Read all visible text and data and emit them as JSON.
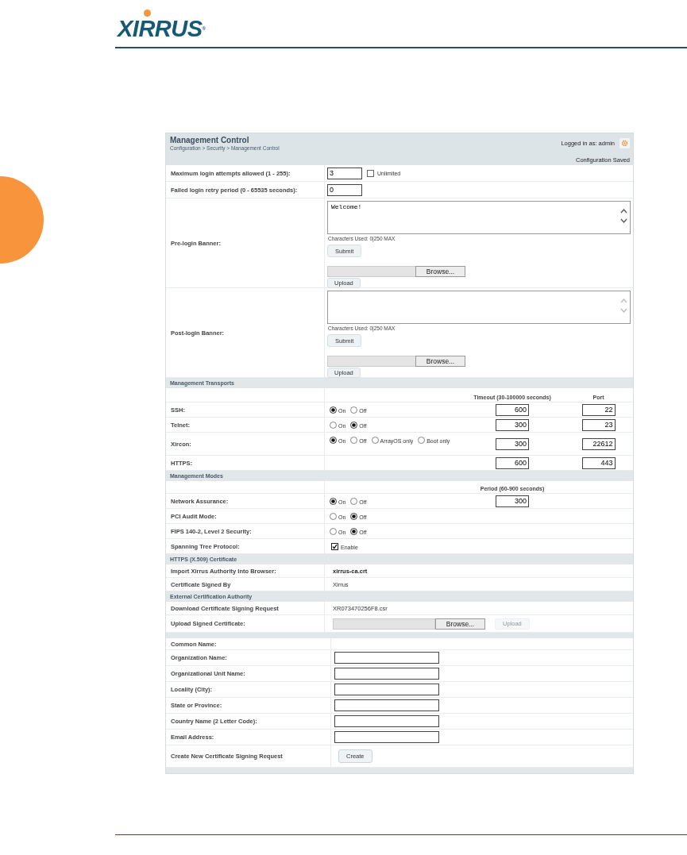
{
  "logo": {
    "text": "XIRRUS",
    "mark": "®"
  },
  "panel": {
    "title": "Management Control",
    "breadcrumb": "Configuration > Security > Management Control",
    "logged_in": "Logged in as: admin",
    "status": "Configuration Saved"
  },
  "login_settings": [
    {
      "label": "Maximum login attempts allowed (1 - 255):",
      "value": "3",
      "checkbox": {
        "label": "Unlimited",
        "checked": false
      }
    },
    {
      "label": "Failed login retry period (0 - 65535 seconds):",
      "value": "0"
    }
  ],
  "banners": [
    {
      "label": "Pre-login Banner:",
      "text": "Welcome!",
      "counter": "Characters Used: 0|250 MAX",
      "submit": "Submit",
      "browse": "Browse...",
      "upload": "Upload"
    },
    {
      "label": "Post-login Banner:",
      "counter": "Characters Used: 0|250 MAX",
      "submit": "Submit",
      "browse": "Browse...",
      "upload": "Upload"
    }
  ],
  "transports": {
    "title": "Management Transports",
    "timeout_heading": "Timeout (30-100000 seconds)",
    "port_heading": "Port",
    "rows": [
      {
        "label": "SSH:",
        "options": [
          {
            "label": "On",
            "selected": true
          },
          {
            "label": "Off",
            "selected": false
          }
        ],
        "timeout": "600",
        "port": "22"
      },
      {
        "label": "Telnet:",
        "options": [
          {
            "label": "On",
            "selected": false
          },
          {
            "label": "Off",
            "selected": true
          }
        ],
        "timeout": "300",
        "port": "23"
      },
      {
        "label": "Xircon:",
        "options": [
          {
            "label": "On",
            "selected": true
          },
          {
            "label": "Off",
            "selected": false
          },
          {
            "label": "ArrayOS only",
            "selected": false
          },
          {
            "label": "Boot only",
            "selected": false
          }
        ],
        "timeout": "300",
        "port": "22612"
      },
      {
        "label": "HTTPS:",
        "timeout": "600",
        "port": "443"
      }
    ]
  },
  "modes": {
    "title": "Management Modes",
    "period_heading": "Period (60-900 seconds)",
    "rows": [
      {
        "kind": "radio",
        "label": "Network Assurance:",
        "options": [
          {
            "label": "On",
            "selected": true
          },
          {
            "label": "Off",
            "selected": false
          }
        ],
        "period": "300"
      },
      {
        "kind": "radio",
        "label": "PCI Audit Mode:",
        "options": [
          {
            "label": "On",
            "selected": false
          },
          {
            "label": "Off",
            "selected": true
          }
        ]
      },
      {
        "kind": "radio",
        "label": "FIPS 140-2, Level 2 Security:",
        "options": [
          {
            "label": "On",
            "selected": false
          },
          {
            "label": "Off",
            "selected": true
          }
        ]
      },
      {
        "kind": "checkbox",
        "label": "Spanning Tree Protocol:",
        "checkbox": {
          "label": "Enable",
          "checked": true
        }
      }
    ]
  },
  "certificate": {
    "title": "HTTPS (X.509) Certificate",
    "rows": [
      {
        "label": "Import Xirrus Authority Into Browser:",
        "value": "xirrus-ca.crt",
        "link": true
      },
      {
        "label": "Certificate Signed By",
        "value": "Xirrus",
        "link": false
      }
    ]
  },
  "external": {
    "title": "External Certification Authority",
    "download": {
      "label": "Download Certificate Signing Request",
      "value": "XR073470256F8.csr"
    },
    "upload": {
      "label": "Upload Signed Certificate:",
      "browse": "Browse...",
      "button": "Upload",
      "disabled": true
    }
  },
  "csr": {
    "common_name": "Common Name:",
    "fields": [
      "Organization Name:",
      "Organizational Unit Name:",
      "Locality (City):",
      "State or Province:",
      "Country Name (2 Letter Code):",
      "Email Address:"
    ],
    "create": {
      "label": "Create New Certificate Signing Request",
      "button": "Create"
    }
  }
}
